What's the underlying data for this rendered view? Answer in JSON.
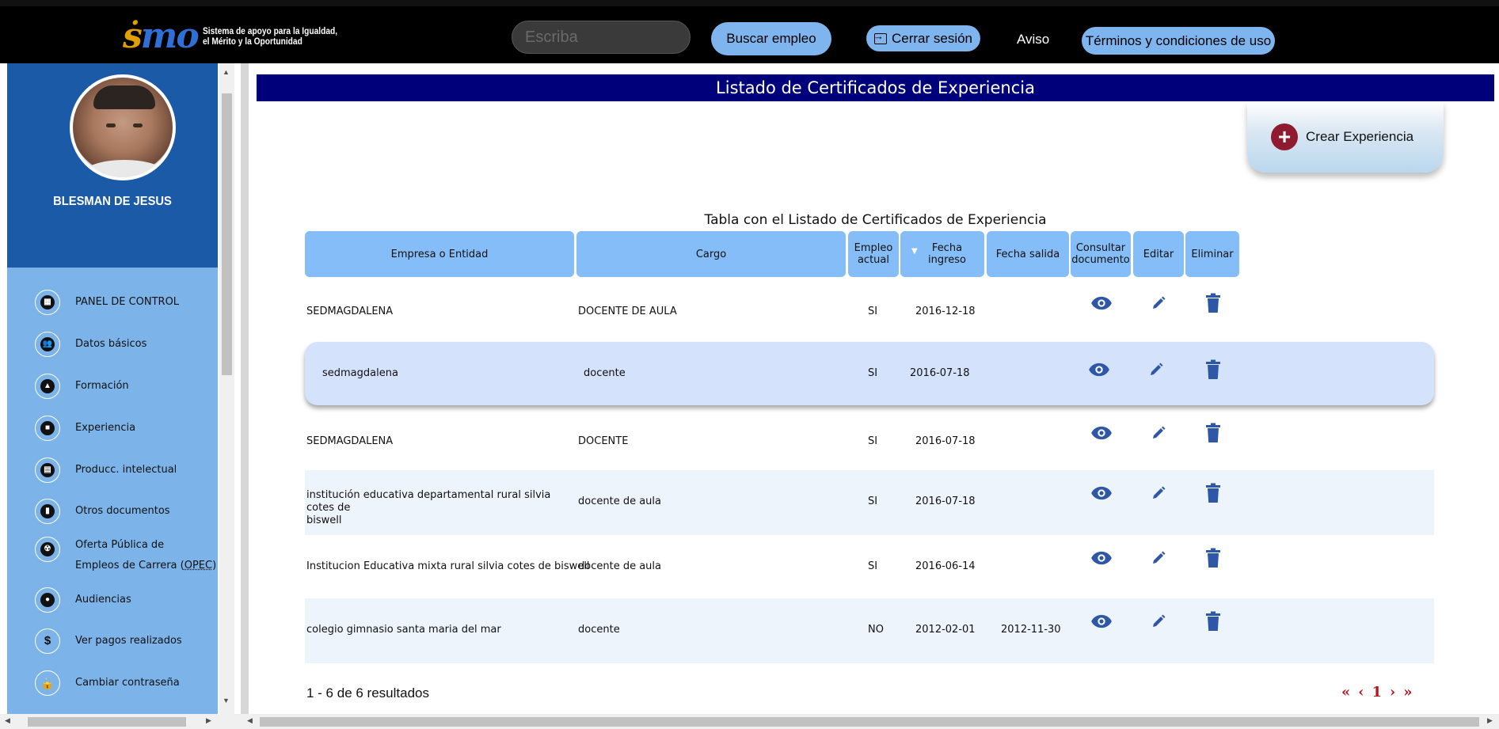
{
  "header": {
    "logo_text_line1": "Sistema de apoyo para la Igualdad,",
    "logo_text_line2": "el Mérito y la Oportunidad",
    "search_placeholder": "Escriba",
    "buscar_label": "Buscar empleo",
    "cerrar_label": "Cerrar sesión",
    "aviso_label": "Aviso",
    "terminos_label": "Términos y condiciones de uso"
  },
  "profile": {
    "name": "BLESMAN DE JESUS"
  },
  "sidebar": {
    "items": [
      {
        "label": "PANEL DE CONTROL",
        "icon": "dashboard-icon"
      },
      {
        "label": "Datos básicos",
        "icon": "people-icon"
      },
      {
        "label": "Formación",
        "icon": "graduation-icon"
      },
      {
        "label": "Experiencia",
        "icon": "briefcase-icon"
      },
      {
        "label": "Producc. intelectual",
        "icon": "library-icon"
      },
      {
        "label": "Otros documentos",
        "icon": "document-icon"
      },
      {
        "label": "Oferta Pública de",
        "label2": "Empleos de Carrera (",
        "label3": "OPEC",
        "label4": ")",
        "icon": "radiation-icon"
      },
      {
        "label": "Audiencias",
        "icon": "voice-icon"
      },
      {
        "label": "Ver pagos realizados",
        "icon": "dollar-icon"
      },
      {
        "label": "Cambiar contraseña",
        "icon": "lock-icon"
      }
    ]
  },
  "main": {
    "title": "Listado de Certificados de Experiencia",
    "crear_label": "Crear Experiencia",
    "caption": "Tabla con el Listado de Certificados de Experiencia",
    "columns": {
      "empresa": "Empresa o Entidad",
      "cargo": "Cargo",
      "empleo_1": "Empleo",
      "empleo_2": "actual",
      "ingreso_1": "Fecha",
      "ingreso_2": "ingreso",
      "salida": "Fecha salida",
      "consultar_1": "Consultar",
      "consultar_2": "documento",
      "editar": "Editar",
      "eliminar": "Eliminar"
    },
    "rows": [
      {
        "empresa": "SEDMAGDALENA",
        "empresa2": "",
        "cargo": "DOCENTE DE AULA",
        "actual": "SI",
        "ingreso": "2016-12-18",
        "salida": ""
      },
      {
        "empresa": "sedmagdalena",
        "empresa2": "",
        "cargo": "docente",
        "actual": "SI",
        "ingreso": "2016-07-18",
        "salida": ""
      },
      {
        "empresa": "SEDMAGDALENA",
        "empresa2": "",
        "cargo": "DOCENTE",
        "actual": "SI",
        "ingreso": "2016-07-18",
        "salida": ""
      },
      {
        "empresa": "institución educativa departamental rural silvia cotes de",
        "empresa2": "biswell",
        "cargo": "docente de aula",
        "actual": "SI",
        "ingreso": "2016-07-18",
        "salida": ""
      },
      {
        "empresa": "Institucion Educativa mixta rural silvia cotes de biswell",
        "empresa2": "",
        "cargo": "docente de aula",
        "actual": "SI",
        "ingreso": "2016-06-14",
        "salida": ""
      },
      {
        "empresa": "colegio gimnasio santa maria del mar",
        "empresa2": "",
        "cargo": "docente",
        "actual": "NO",
        "ingreso": "2012-02-01",
        "salida": "2012-11-30"
      }
    ],
    "results_text": "1 - 6 de 6 resultados",
    "pager": {
      "first": "«",
      "prev": "‹",
      "page": "1",
      "next": "›",
      "last": "»"
    }
  },
  "colors": {
    "topbar": "#000000",
    "title_bar": "#00007a",
    "sidebar": "#7cb4ea",
    "profile_bg": "#1a5aa6",
    "header_cells": "#84bdf7",
    "action_icons": "#2f57a8",
    "pager": "#b8141f"
  }
}
